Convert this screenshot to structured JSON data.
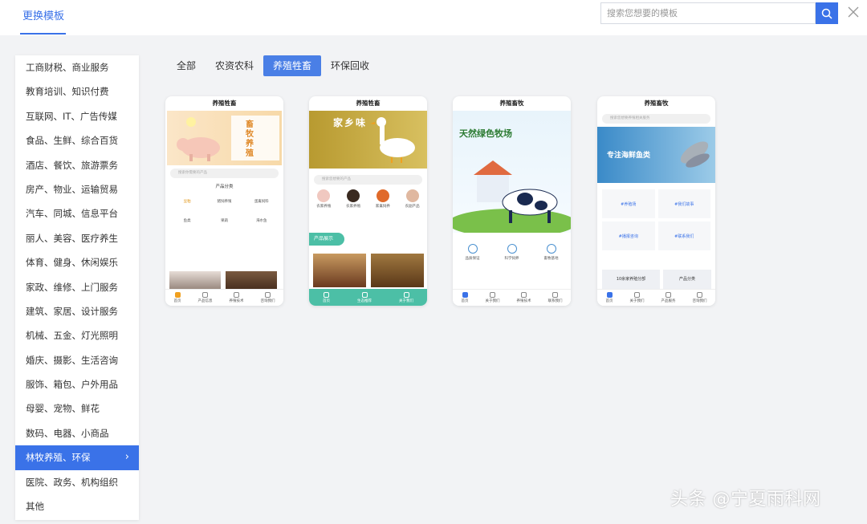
{
  "header": {
    "tab_label": "更换模板",
    "search_placeholder": "搜索您想要的模板",
    "accent_color": "#3a72e8"
  },
  "sidebar": {
    "items": [
      {
        "label": "工商财税、商业服务"
      },
      {
        "label": "教育培训、知识付费"
      },
      {
        "label": "互联网、IT、广告传媒"
      },
      {
        "label": "食品、生鲜、综合百货"
      },
      {
        "label": "酒店、餐饮、旅游票务"
      },
      {
        "label": "房产、物业、运输贸易"
      },
      {
        "label": "汽车、同城、信息平台"
      },
      {
        "label": "丽人、美容、医疗养生"
      },
      {
        "label": "体育、健身、休闲娱乐"
      },
      {
        "label": "家政、维修、上门服务"
      },
      {
        "label": "建筑、家居、设计服务"
      },
      {
        "label": "机械、五金、灯光照明"
      },
      {
        "label": "婚庆、摄影、生活咨询"
      },
      {
        "label": "服饰、箱包、户外用品"
      },
      {
        "label": "母婴、宠物、鲜花"
      },
      {
        "label": "数码、电器、小商品"
      },
      {
        "label": "林牧养殖、环保"
      },
      {
        "label": "医院、政务、机构组织"
      },
      {
        "label": "其他"
      }
    ],
    "active_index": 16
  },
  "filters": {
    "items": [
      {
        "label": "全部"
      },
      {
        "label": "农资农科"
      },
      {
        "label": "养殖牲畜"
      },
      {
        "label": "环保回收"
      }
    ],
    "active_index": 2
  },
  "templates": [
    {
      "title": "养殖牲畜",
      "banner_title": "畜牧养殖",
      "search_hint": "搜索你需要的产品",
      "section_title": "产品分类",
      "grid": [
        "豆粕",
        "猪饲养殖",
        "蛋禽饲料",
        "鱼类",
        "果蔬",
        "海水鱼"
      ],
      "tabs": [
        "首页",
        "产品信息",
        "养殖技术",
        "咨询我们"
      ]
    },
    {
      "title": "养殖牲畜",
      "banner_title": "家乡味",
      "search_hint": "搜索您想要的产品",
      "icons": [
        "农家养殖",
        "农家养殖",
        "家禽饲养",
        "农副产品"
      ],
      "section_tag": "产品展示",
      "tabs": [
        "首页",
        "生态推荐",
        "关于我们"
      ]
    },
    {
      "title": "养殖畜牧",
      "banner_title": "天然绿色牧场",
      "features": [
        "品质保证",
        "科学饲养",
        "畜牧基地"
      ],
      "tabs": [
        "首页",
        "关于我们",
        "养殖技术",
        "联系我们"
      ]
    },
    {
      "title": "养殖畜牧",
      "search_hint": "搜索您想要养殖相关服务",
      "banner_title": "专注海鲜鱼类",
      "tiles": [
        "#养殖场",
        "#我们故事",
        "#播报咨询",
        "#联系我们"
      ],
      "bottom_left": "10余家养殖分部",
      "bottom_right": "产品分类",
      "tabs": [
        "首页",
        "关于我们",
        "产品服务",
        "咨询我们"
      ]
    }
  ],
  "watermark": "头条 @宁夏雨科网"
}
